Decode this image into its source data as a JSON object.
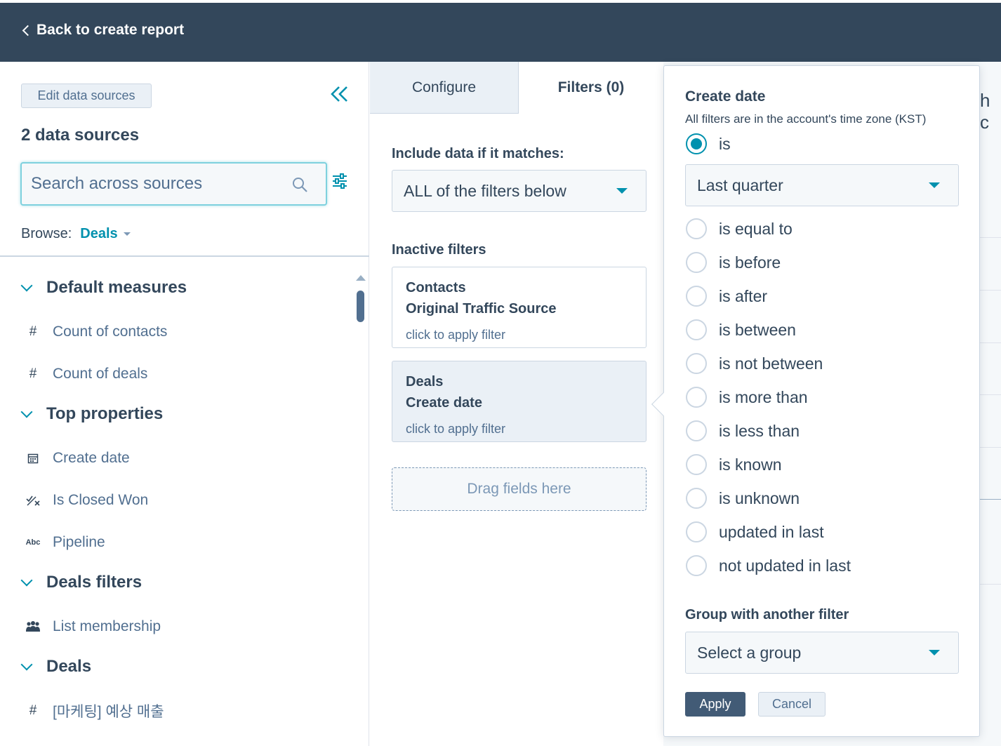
{
  "header": {
    "back_label": "Back to create report"
  },
  "sidebar": {
    "edit_sources_label": "Edit data sources",
    "sources_title": "2 data sources",
    "search": {
      "placeholder": "Search across sources",
      "value": ""
    },
    "browse_label": "Browse:",
    "browse_value": "Deals",
    "groups": [
      {
        "title": "Default measures",
        "items": [
          {
            "label": "Count of contacts",
            "icon": "#"
          },
          {
            "label": "Count of deals",
            "icon": "#"
          }
        ]
      },
      {
        "title": "Top properties",
        "items": [
          {
            "label": "Create date",
            "icon": "calendar-icon"
          },
          {
            "label": "Is Closed Won",
            "icon": "boolean-icon"
          },
          {
            "label": "Pipeline",
            "icon": "Abc"
          }
        ]
      },
      {
        "title": "Deals filters",
        "items": [
          {
            "label": "List membership",
            "icon": "people-icon"
          }
        ]
      },
      {
        "title": "Deals",
        "items": [
          {
            "label": "[마케팅] 예상 매출",
            "icon": "#"
          }
        ]
      }
    ]
  },
  "middle": {
    "tabs": [
      {
        "label": "Configure"
      },
      {
        "label": "Filters (0)"
      }
    ],
    "include_label": "Include data if it matches:",
    "include_value": "ALL of the filters below",
    "inactive_label": "Inactive filters",
    "filters": [
      {
        "line1": "Contacts",
        "line2": "Original Traffic Source",
        "hint": "click to apply filter"
      },
      {
        "line1": "Deals",
        "line2": "Create date",
        "hint": "click to apply filter"
      }
    ],
    "drop_zone": "Drag fields here"
  },
  "background": {
    "partial_text": "h c"
  },
  "popover": {
    "title": "Create date",
    "subtitle": "All filters are in the account's time zone (KST)",
    "selected_operator": "is",
    "period_value": "Last quarter",
    "options": [
      "is equal to",
      "is before",
      "is after",
      "is between",
      "is not between",
      "is more than",
      "is less than",
      "is known",
      "is unknown",
      "updated in last",
      "not updated in last"
    ],
    "group_label": "Group with another filter",
    "group_value": "Select a group",
    "apply_label": "Apply",
    "cancel_label": "Cancel"
  },
  "colors": {
    "header_bg": "#33475b",
    "accent": "#0091ae",
    "apply_bg": "#425b76"
  }
}
